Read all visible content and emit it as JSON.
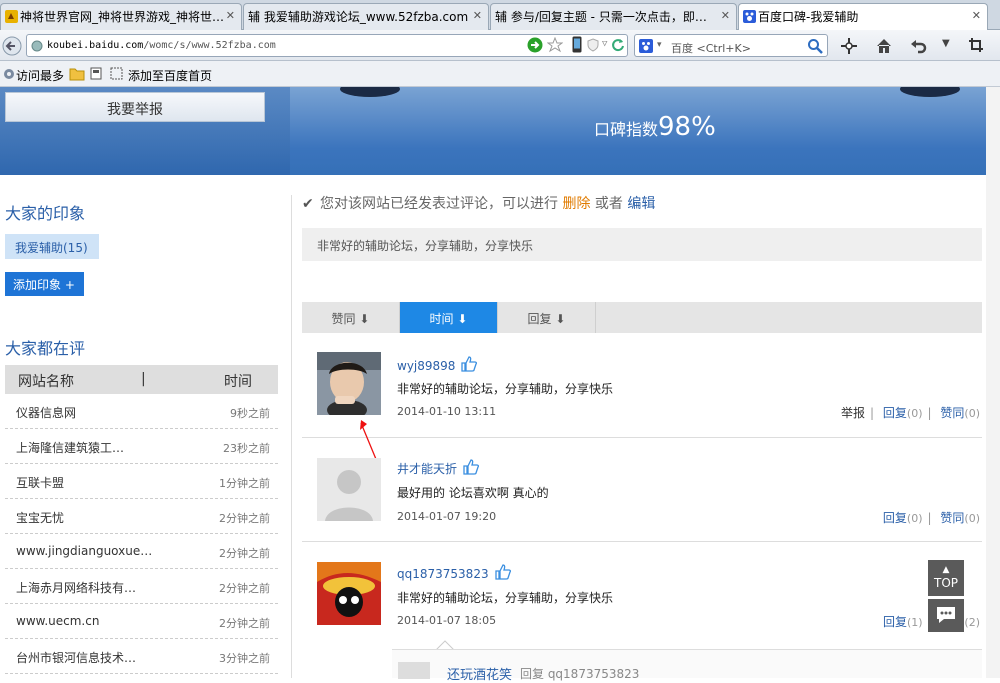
{
  "tabs": [
    {
      "title": "神将世界官网_神将世界游戏_神将世…",
      "active": false
    },
    {
      "title": "辅 我爱辅助游戏论坛_www.52fzba.com",
      "active": false
    },
    {
      "title": "辅 参与/回复主题 - 只需一次点击，即…",
      "active": false
    },
    {
      "title": "百度口碑-我爱辅助",
      "active": true
    }
  ],
  "address": {
    "domain": "koubei.baidu.com",
    "path": "/womc/s/www.52fzba.com"
  },
  "search": {
    "placeholder": "百度 <Ctrl+K>"
  },
  "bookmarks": {
    "most_visited": "访问最多",
    "add_home": "添加至百度首页"
  },
  "left": {
    "report_button": "我要举报",
    "impressions_title": "大家的印象",
    "tag": "我爱辅助(15)",
    "add_tag_button": "添加印象 +",
    "reviewing_title": "大家都在评",
    "list_header": {
      "name": "网站名称",
      "divider": "|",
      "time": "时间"
    },
    "rows": [
      {
        "name": "仪器信息网",
        "time": "9秒之前"
      },
      {
        "name": "上海隆信建筑猿工…",
        "time": "23秒之前"
      },
      {
        "name": "互联卡盟",
        "time": "1分钟之前"
      },
      {
        "name": "宝宝无忧",
        "time": "2分钟之前"
      },
      {
        "name": "www.jingdianguoxue…",
        "time": "2分钟之前"
      },
      {
        "name": "上海赤月网络科技有…",
        "time": "2分钟之前"
      },
      {
        "name": "www.uecm.cn",
        "time": "2分钟之前"
      },
      {
        "name": "台州市银河信息技术…",
        "time": "3分钟之前"
      }
    ]
  },
  "score": {
    "label": "口碑指数",
    "value": "98%"
  },
  "notice": {
    "text": "您对该网站已经发表过评论，可以进行",
    "delete": "删除",
    "or": "或者",
    "edit": "编辑"
  },
  "my_comment": "非常好的辅助论坛，分享辅助，分享快乐",
  "sort": {
    "agree": "赞同",
    "time": "时间",
    "reply": "回复"
  },
  "comments": [
    {
      "user": "wyj89898",
      "text": "非常好的辅助论坛，分享辅助，分享快乐",
      "time": "2014-01-10 13:11",
      "report": "举报",
      "reply": "回复",
      "reply_count": "(0)",
      "agree": "赞同",
      "agree_count": "(0)"
    },
    {
      "user": "井才能天折",
      "text": "最好用的 论坛喜欢啊 真心的",
      "time": "2014-01-07 19:20",
      "reply": "回复",
      "reply_count": "(0)",
      "agree": "赞同",
      "agree_count": "(0)"
    },
    {
      "user": "qq1873753823",
      "text": "非常好的辅助论坛，分享辅助，分享快乐",
      "time": "2014-01-07 18:05",
      "reply": "回复",
      "reply_count": "(1)",
      "agree_count": "(2)"
    }
  ],
  "partial_reply": {
    "user": "还玩酒花笑",
    "text": "回复 qq1873753823"
  },
  "top_button": "TOP",
  "colors": {
    "accent": "#1e88e5",
    "link": "#2a5fa8",
    "delete": "#e07b00"
  }
}
